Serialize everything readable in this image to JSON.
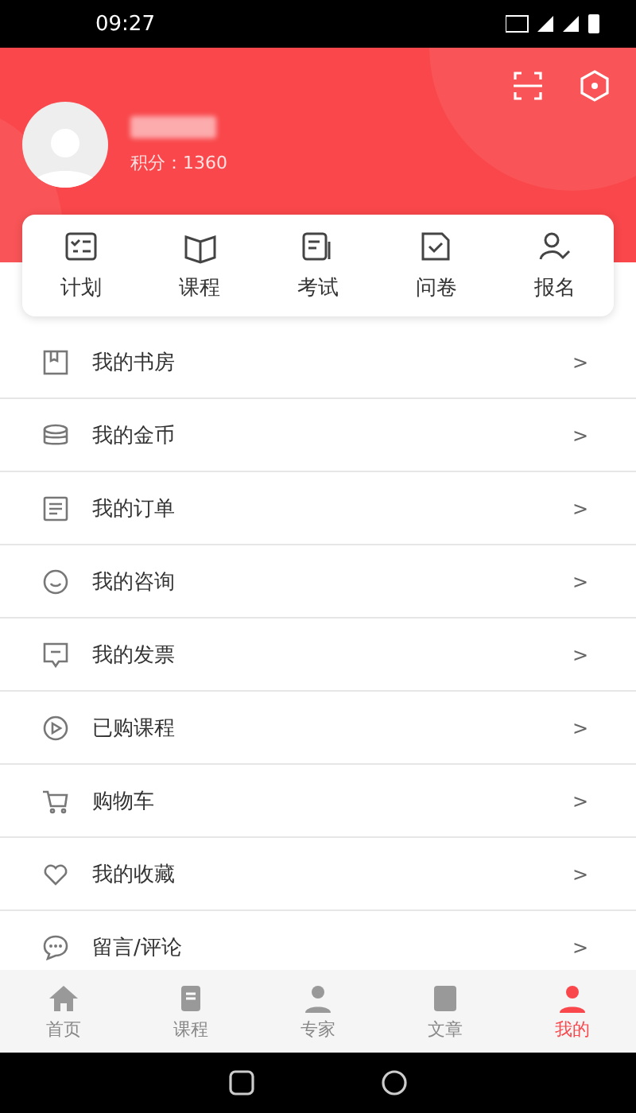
{
  "status_bar": {
    "time": "09:27"
  },
  "profile": {
    "points": "积分：1360"
  },
  "shortcuts": [
    {
      "label": "计划",
      "kind": "plan"
    },
    {
      "label": "课程",
      "kind": "book"
    },
    {
      "label": "考试",
      "kind": "exam"
    },
    {
      "label": "问卷",
      "kind": "survey"
    },
    {
      "label": "报名",
      "kind": "signup"
    }
  ],
  "menu": [
    {
      "label": "我的书房",
      "kind": "study",
      "chevron": ">"
    },
    {
      "label": "我的金币",
      "kind": "coins",
      "chevron": ">"
    },
    {
      "label": "我的订单",
      "kind": "orders",
      "chevron": ">"
    },
    {
      "label": "我的咨询",
      "kind": "consult",
      "chevron": ">"
    },
    {
      "label": "我的发票",
      "kind": "invoice",
      "chevron": ">"
    },
    {
      "label": "已购课程",
      "kind": "purchased",
      "chevron": ">"
    },
    {
      "label": "购物车",
      "kind": "cart",
      "chevron": ">"
    },
    {
      "label": "我的收藏",
      "kind": "favorite",
      "chevron": ">"
    },
    {
      "label": "留言/评论",
      "kind": "comment",
      "chevron": ">"
    }
  ],
  "tab_bar": [
    {
      "label": "首页",
      "kind": "home",
      "selected": false
    },
    {
      "label": "课程",
      "kind": "course",
      "selected": false
    },
    {
      "label": "专家",
      "kind": "expert",
      "selected": false
    },
    {
      "label": "文章",
      "kind": "article",
      "selected": false
    },
    {
      "label": "我的",
      "kind": "me",
      "selected": true
    }
  ]
}
